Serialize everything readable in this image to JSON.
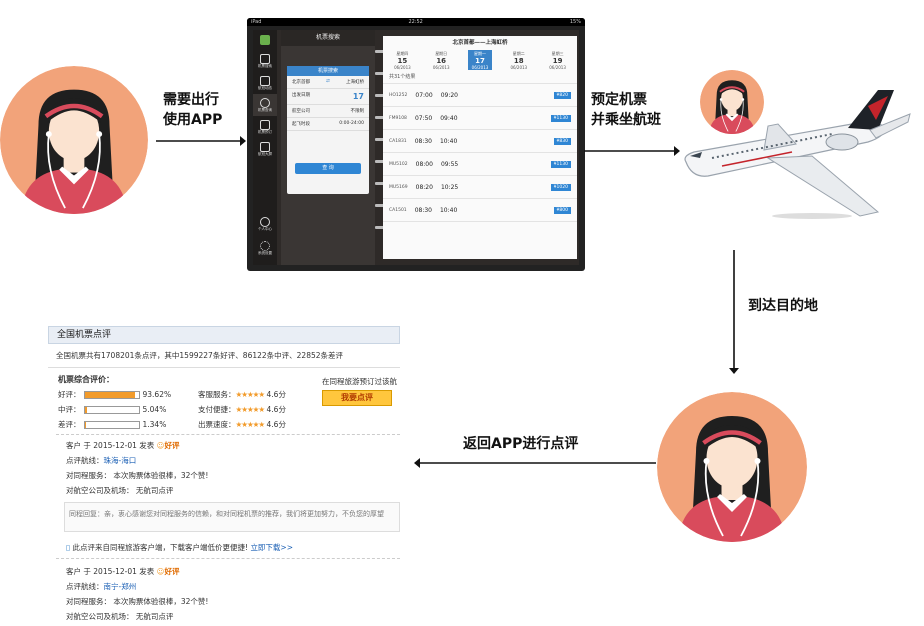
{
  "labels": {
    "need_travel": "需要出行\n使用APP",
    "book_ticket": "预定机票\n并乘坐航班",
    "arrive": "到达目的地",
    "return_review": "返回APP进行点评"
  },
  "tablet": {
    "status_left": "iPad",
    "status_time": "22:52",
    "status_right": "15%",
    "left_header": "机票搜索",
    "card_header": "机票搜索",
    "from_label": "出发",
    "to_label": "到达",
    "from_city": "北京首都",
    "to_city": "上海虹桥",
    "date_label": "出发日期",
    "date_value": "17",
    "airline_label": "航空公司",
    "airline_value": "不限制",
    "time_label": "起飞时段",
    "time_value": "0:00-24:00",
    "search_button": "查 询",
    "sidebar": [
      "机票搜索",
      "航班动态",
      "机票查询",
      "机票预订",
      "航班大屏",
      "个人中心",
      "系统设置"
    ],
    "route_title": "北京首都——上海虹桥",
    "dates": [
      {
        "week": "星期四",
        "day": "15",
        "sub": "06/2013"
      },
      {
        "week": "星期日",
        "day": "16",
        "sub": "06/2013"
      },
      {
        "week": "星期一",
        "day": "17",
        "sub": "06/2013"
      },
      {
        "week": "星期二",
        "day": "18",
        "sub": "06/2013"
      },
      {
        "week": "星期三",
        "day": "19",
        "sub": "06/2013"
      }
    ],
    "result_count": "共31个结果",
    "flights": [
      {
        "code": "HO1252",
        "dep": "07:00",
        "arr": "09:20",
        "price": "¥820"
      },
      {
        "code": "FM9108",
        "dep": "07:50",
        "arr": "09:40",
        "price": "¥1130"
      },
      {
        "code": "CA1831",
        "dep": "08:30",
        "arr": "10:40",
        "price": "¥830"
      },
      {
        "code": "MU5102",
        "dep": "08:00",
        "arr": "09:55",
        "price": "¥1130"
      },
      {
        "code": "MU5169",
        "dep": "08:20",
        "arr": "10:25",
        "price": "¥1020"
      },
      {
        "code": "CA1501",
        "dep": "08:30",
        "arr": "10:40",
        "price": "¥800"
      }
    ]
  },
  "review": {
    "title": "全国机票点评",
    "summary": "全国机票共有1708201条点评，其中1599227条好评、86122条中评、22852条差评",
    "overall_heading": "机票综合评价：",
    "ratings": [
      {
        "label": "好评：",
        "fill": 0.9382,
        "pct": "93.62%"
      },
      {
        "label": "中评：",
        "fill": 0.0504,
        "pct": "5.04%"
      },
      {
        "label": "差评：",
        "fill": 0.0134,
        "pct": "1.34%"
      }
    ],
    "scores": [
      {
        "label": "客服服务：",
        "stars": "★★★★★",
        "score": "4.6分"
      },
      {
        "label": "支付便捷：",
        "stars": "★★★★★",
        "score": "4.6分"
      },
      {
        "label": "出票速度：",
        "stars": "★★★★★",
        "score": "4.6分"
      }
    ],
    "prompt": "在同程旅游预订过该航",
    "review_button": "我要点评",
    "entries": [
      {
        "user": "客户 于",
        "date": "2015-12-01 发表",
        "tag": "好评",
        "route_label": "点评航线：",
        "route": "珠海-海口",
        "service": "对同程服务：  本次购票体验很棒，32个赞!",
        "airline": "对航空公司及机场：  无航司点评"
      },
      {
        "user": "客户 于",
        "date": "2015-12-01 发表",
        "tag": "好评",
        "route_label": "点评航线：",
        "route": "南宁-郑州",
        "service": "对同程服务：  本次购票体验很棒，32个赞!",
        "airline": "对航空公司及机场：  无航司点评"
      }
    ],
    "reply": "同程回复：亲，衷心感谢您对同程服务的信赖，和对同程机票的推荐，我们将更加努力，不负您的厚望",
    "app_note": "此点评来自同程旅游客户端，下载客户端低价更便捷!",
    "download": "立即下载>>"
  },
  "colors": {
    "accent_blue": "#2f86d4",
    "bar_orange": "#f29b2b",
    "avatar_bg": "#f2a37a",
    "shirt": "#d94b5c"
  }
}
